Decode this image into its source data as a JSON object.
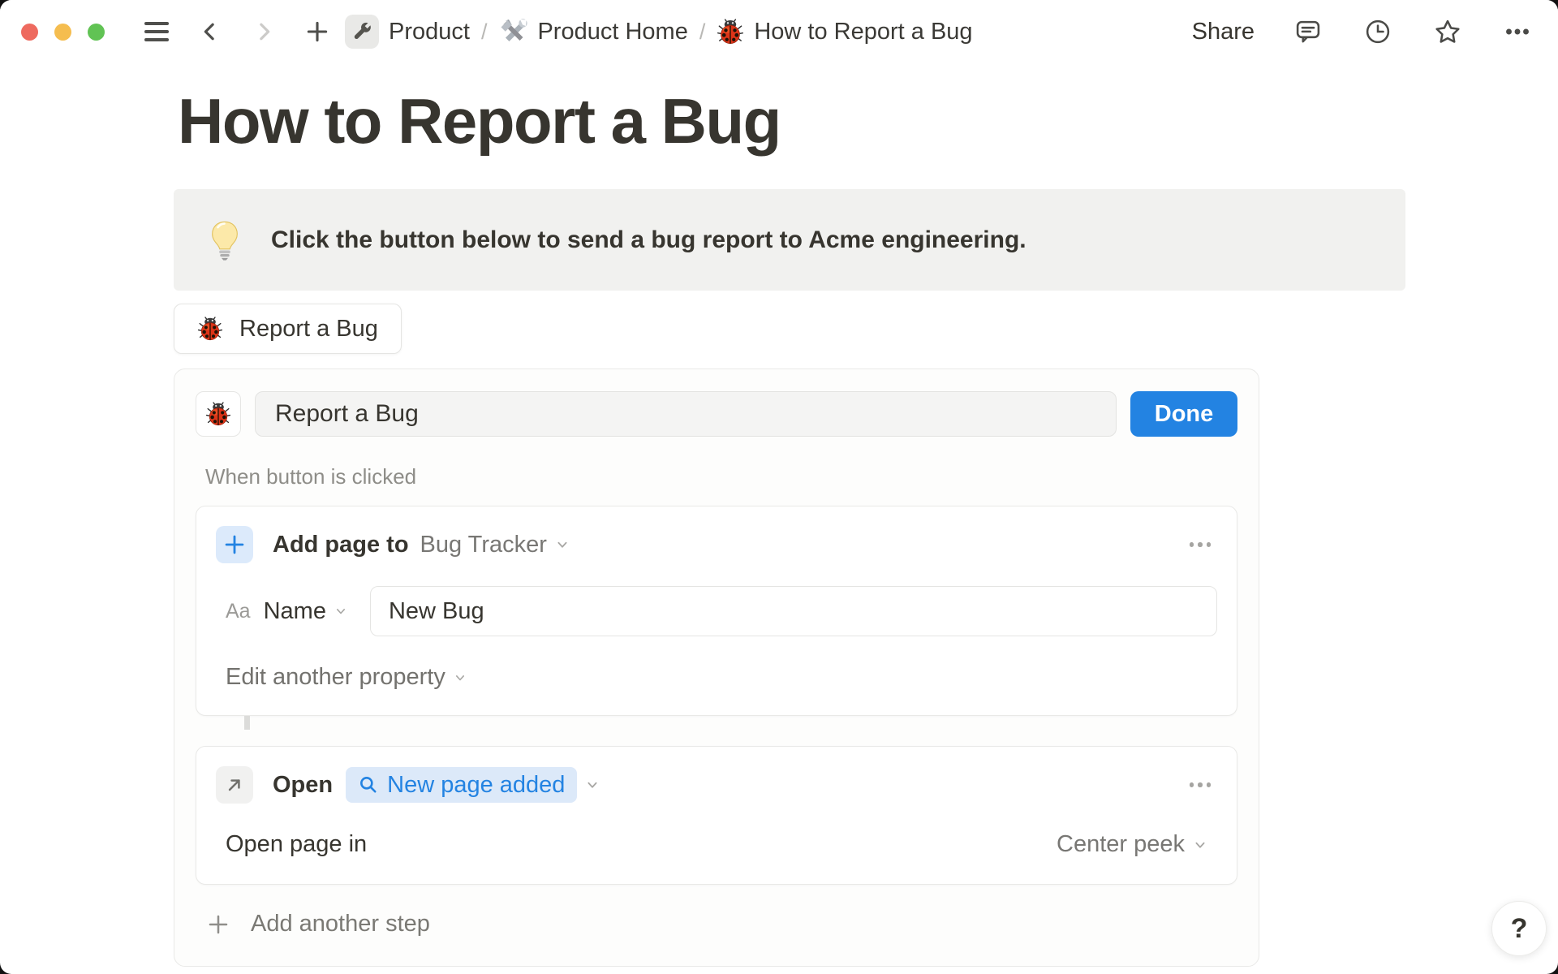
{
  "colors": {
    "accent_blue": "#2383E2",
    "chip_background": "#DCE9F9",
    "callout_background": "#F1F1EF",
    "panel_background": "#FDFDFC",
    "text_dark": "#37352F",
    "text_gray": "#787774",
    "traffic_red": "#EE6A5F",
    "traffic_yellow": "#F5BD4F",
    "traffic_green": "#61C354"
  },
  "icons": {
    "toolbar": [
      "hamburger-icon",
      "back-chevron-icon",
      "forward-chevron-icon",
      "new-page-plus-icon",
      "comments-icon",
      "updates-clock-icon",
      "favorite-star-icon",
      "more-ellipsis-icon"
    ],
    "breadcrumb": [
      "wrench-icon",
      "hammer-wrench-icon",
      "ladybug-icon"
    ],
    "other": [
      "light-bulb-icon",
      "ladybug-icon",
      "plus-icon",
      "open-arrow-icon",
      "search-icon",
      "chevron-down-icon",
      "question-mark"
    ]
  },
  "toolbar": {
    "share_label": "Share",
    "breadcrumb": {
      "separator": "/",
      "items": [
        {
          "icon": "wrench-icon",
          "label": "Product"
        },
        {
          "icon": "hammer-wrench-icon",
          "label": "Product Home"
        },
        {
          "icon": "ladybug-icon",
          "label": "How to Report a Bug"
        }
      ]
    }
  },
  "page": {
    "title": "How to Report a Bug",
    "callout": {
      "icon": "light-bulb-icon",
      "text": "Click the button below to send a bug report to Acme engineering."
    },
    "bug_button": {
      "icon": "ladybug-icon",
      "label": "Report a Bug"
    }
  },
  "button_editor": {
    "icon": "ladybug-icon",
    "button_name_value": "Report a Bug",
    "done_label": "Done",
    "trigger_label": "When button is clicked",
    "step_add_page": {
      "action_label": "Add page to",
      "target_label": "Bug Tracker",
      "property_type_label": "Aa",
      "property_name": "Name",
      "property_value": "New Bug",
      "edit_another_label": "Edit another property"
    },
    "step_open": {
      "action_label": "Open",
      "target_chip_label": "New page added",
      "open_page_in_label": "Open page in",
      "open_mode_value": "Center peek"
    },
    "add_step_label": "Add another step"
  },
  "help": {
    "label": "?"
  }
}
